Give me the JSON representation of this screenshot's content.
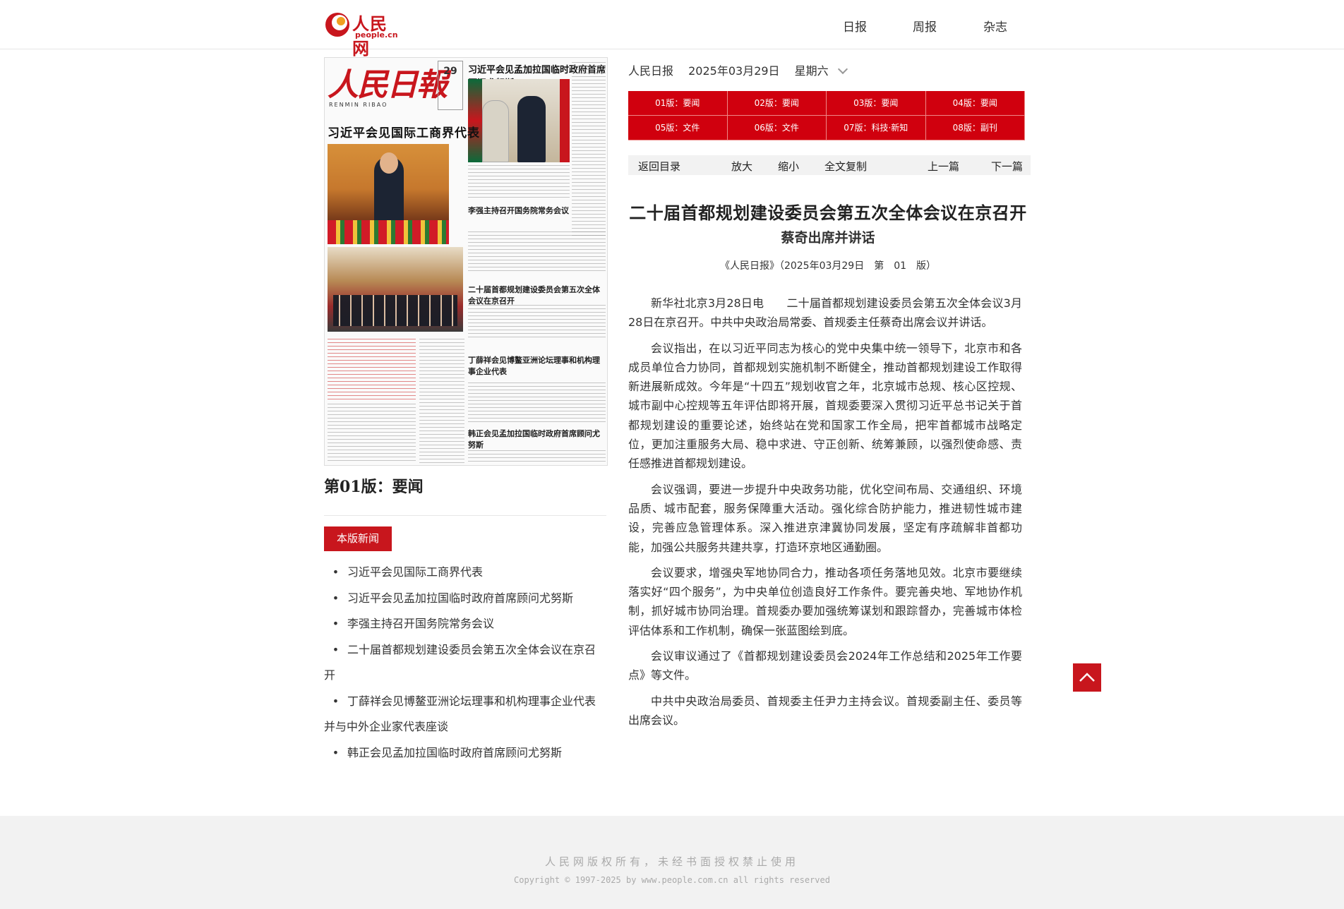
{
  "header": {
    "logo_text": "人民网",
    "logo_sub": "people.cn",
    "nav": [
      "日报",
      "周报",
      "杂志"
    ]
  },
  "paper": {
    "masthead": "人民日報",
    "masthead_en": "RENMIN RIBAO",
    "date_day": "29",
    "headline_left": "习近平会见国际工商界代表",
    "headline_right": "习近平会见孟加拉国临时政府首席顾问尤努斯",
    "sub1": "李强主持召开国务院常务会议",
    "sub2": "二十届首都规划建设委员会第五次全体会议在京召开",
    "sub3": "丁薛祥会见博鳌亚洲论坛理事和机构理事企业代表",
    "sub4": "韩正会见孟加拉国临时政府首席顾问尤努斯"
  },
  "left": {
    "section_title": "第01版：要闻",
    "badge": "本版新闻",
    "bullet": "•",
    "news": [
      "习近平会见国际工商界代表",
      "习近平会见孟加拉国临时政府首席顾问尤努斯",
      "李强主持召开国务院常务会议",
      "二十届首都规划建设委员会第五次全体会议在京召开",
      "丁薛祥会见博鳌亚洲论坛理事和机构理事企业代表并与中外企业家代表座谈",
      "韩正会见孟加拉国临时政府首席顾问尤努斯"
    ]
  },
  "meta": {
    "paper_name": "人民日报",
    "date": "2025年03月29日",
    "weekday": "星期六"
  },
  "pages": [
    "01版：要闻",
    "02版：要闻",
    "03版：要闻",
    "04版：要闻",
    "05版：文件",
    "06版：文件",
    "07版：科技·新知",
    "08版：副刊"
  ],
  "toolbar": {
    "back": "返回目录",
    "zoom_in": "放大",
    "zoom_out": "缩小",
    "copy_all": "全文复制",
    "prev": "上一篇",
    "next": "下一篇"
  },
  "article": {
    "title": "二十届首都规划建设委员会第五次全体会议在京召开",
    "subtitle": "蔡奇出席并讲话",
    "source": "《人民日报》（2025年03月29日　第　01　版）",
    "paragraphs": [
      "新华社北京3月28日电　　二十届首都规划建设委员会第五次全体会议3月28日在京召开。中共中央政治局常委、首规委主任蔡奇出席会议并讲话。",
      "会议指出，在以习近平同志为核心的党中央集中统一领导下，北京市和各成员单位合力协同，首都规划实施机制不断健全，推动首都规划建设工作取得新进展新成效。今年是“十四五”规划收官之年，北京城市总规、核心区控规、城市副中心控规等五年评估即将开展，首规委要深入贯彻习近平总书记关于首都规划建设的重要论述，始终站在党和国家工作全局，把牢首都城市战略定位，更加注重服务大局、稳中求进、守正创新、统筹兼顾，以强烈使命感、责任感推进首都规划建设。",
      "会议强调，要进一步提升中央政务功能，优化空间布局、交通组织、环境品质、城市配套，服务保障重大活动。强化综合防护能力，推进韧性城市建设，完善应急管理体系。深入推进京津冀协同发展，坚定有序疏解非首都功能，加强公共服务共建共享，打造环京地区通勤圈。",
      "会议要求，增强央军地协同合力，推动各项任务落地见效。北京市要继续落实好“四个服务”，为中央单位创造良好工作条件。要完善央地、军地协作机制，抓好城市协同治理。首规委办要加强统筹谋划和跟踪督办，完善城市体检评估体系和工作机制，确保一张蓝图绘到底。",
      "会议审议通过了《首都规划建设委员会2024年工作总结和2025年工作要点》等文件。",
      "中共中央政治局委员、首规委主任尹力主持会议。首规委副主任、委员等出席会议。"
    ]
  },
  "footer": {
    "line1": "人民网版权所有，未经书面授权禁止使用",
    "line2": "Copyright © 1997-2025 by www.people.com.cn all rights reserved"
  },
  "colors": {
    "brand_red": "#c8161d",
    "page_grid_red": "#d0000e"
  }
}
